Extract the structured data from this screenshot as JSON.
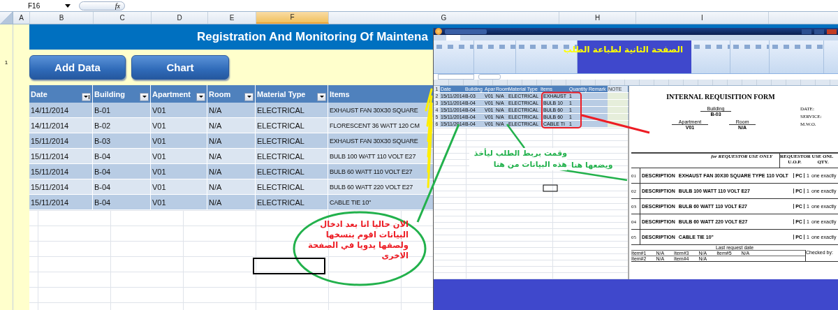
{
  "formula_bar": {
    "cell_ref": "F16",
    "function_label": "fx"
  },
  "column_headers": [
    {
      "label": "A",
      "selected": false
    },
    {
      "label": "B",
      "selected": false
    },
    {
      "label": "C",
      "selected": false
    },
    {
      "label": "D",
      "selected": false
    },
    {
      "label": "E",
      "selected": false
    },
    {
      "label": "F",
      "selected": true
    },
    {
      "label": "G",
      "selected": false
    },
    {
      "label": "H",
      "selected": false
    },
    {
      "label": "I",
      "selected": false
    }
  ],
  "row_headers": [
    "1"
  ],
  "banner": {
    "title": "Registration And Monitoring Of Maintena"
  },
  "buttons": [
    "Add Data",
    "Chart"
  ],
  "table": {
    "columns": [
      {
        "label": "Date",
        "kind": "sort"
      },
      {
        "label": "Building",
        "kind": "dropdown"
      },
      {
        "label": "Apartment",
        "kind": "dropdown"
      },
      {
        "label": "Room",
        "kind": "dropdown"
      },
      {
        "label": "Material Type",
        "kind": "dropdown"
      },
      {
        "label": "Items",
        "kind": "plain"
      }
    ],
    "rows": [
      [
        "14/11/2014",
        "B-01",
        "V01",
        "N/A",
        "ELECTRICAL",
        "EXHAUST FAN 30X30 SQUARE"
      ],
      [
        "14/11/2014",
        "B-02",
        "V01",
        "N/A",
        "ELECTRICAL",
        "FLORESCENT 36 WATT 120 CM"
      ],
      [
        "15/11/2014",
        "B-03",
        "V01",
        "N/A",
        "ELECTRICAL",
        "EXHAUST FAN 30X30 SQUARE"
      ],
      [
        "15/11/2014",
        "B-04",
        "V01",
        "N/A",
        "ELECTRICAL",
        "BULB 100 WATT 110 VOLT E27"
      ],
      [
        "15/11/2014",
        "B-04",
        "V01",
        "N/A",
        "ELECTRICAL",
        "BULB 60 WATT 110 VOLT E27"
      ],
      [
        "15/11/2014",
        "B-04",
        "V01",
        "N/A",
        "ELECTRICAL",
        "BULB 60 WATT 220 VOLT E27"
      ],
      [
        "15/11/2014",
        "B-04",
        "V01",
        "N/A",
        "ELECTRICAL",
        "CABLE TIE 10\""
      ]
    ]
  },
  "note_left": "الان حاليا انا بعد ادخال البيانات اقوم بنسخها ولصقها يدويا في الصفحة الاخرى",
  "inset": {
    "banner_note": "الصفحة الثانية لطباعة الطلب",
    "sheet": {
      "row_numbers": [
        "1",
        "2",
        "3",
        "4",
        "5",
        "6"
      ],
      "columns": [
        "Date",
        "Building",
        "Apar",
        "Room",
        "Material Type",
        "Items",
        "Quantity",
        "Remark",
        "NOTE"
      ],
      "rows": [
        [
          "15/11/2014",
          "B-03",
          "V01",
          "N/A",
          "ELECTRICAL",
          "EXHAUST",
          "1"
        ],
        [
          "15/11/2014",
          "B-04",
          "V01",
          "N/A",
          "ELECTRICAL",
          "BULB 10",
          "1"
        ],
        [
          "15/11/2014",
          "B-04",
          "V01",
          "N/A",
          "ELECTRICAL",
          "BULB 60",
          "1"
        ],
        [
          "15/11/2014",
          "B-04",
          "V01",
          "N/A",
          "ELECTRICAL",
          "BULB 60",
          "1"
        ],
        [
          "15/11/2014",
          "B-04",
          "V01",
          "N/A",
          "ELECTRICAL",
          "CABLE TI",
          "1"
        ]
      ]
    },
    "form": {
      "title": "INTERNAL REQUISITION FORM",
      "fields": [
        {
          "label": "Building",
          "value": "B-03"
        },
        {
          "label": "Apartment",
          "value": "V01"
        },
        {
          "label": "Room",
          "value": "N/A"
        }
      ],
      "meta": [
        "DATE:",
        "SERVICE:",
        "M.W.O."
      ],
      "section_left": "for REQUESTOR USE ONLY",
      "section_right": "REQUESTOR USE ONL",
      "uop_heading": "U.O.P.",
      "qty_heading": "QTY.",
      "items": [
        {
          "number": "01",
          "description_label": "DESCRIPTION",
          "description": "EXHAUST FAN 30X30 SQUARE TYPE 110 VOLT",
          "uop": "PC",
          "qty": "1",
          "note": "one exactly"
        },
        {
          "number": "02",
          "description_label": "DESCRIPTION",
          "description": "BULB 100 WATT 110 VOLT E27",
          "uop": "PC",
          "qty": "1",
          "note": "one exactly"
        },
        {
          "number": "03",
          "description_label": "DESCRIPTION",
          "description": "BULB 60 WATT 110 VOLT E27",
          "uop": "PC",
          "qty": "1",
          "note": "one exactly"
        },
        {
          "number": "04",
          "description_label": "DESCRIPTION",
          "description": "BULB 60 WATT 220 VOLT E27",
          "uop": "PC",
          "qty": "1",
          "note": "one exactly"
        },
        {
          "number": "05",
          "description_label": "DESCRIPTION",
          "description": "CABLE TIE 10\"",
          "uop": "PC",
          "qty": "1",
          "note": "one exactly"
        }
      ],
      "last_request": {
        "title": "Last request date",
        "rows": [
          [
            "Item#1",
            "N/A",
            "Item#3",
            "N/A",
            "Item#5",
            "N/A"
          ],
          [
            "Item#2",
            "N/A",
            "Item#4",
            "N/A"
          ]
        ],
        "checked_by": "Checked by:"
      }
    },
    "note_link": "وقمت بربط الطلب ليأخذ هذه البيانات من هنا",
    "note_place": "ويضعها هنا"
  }
}
